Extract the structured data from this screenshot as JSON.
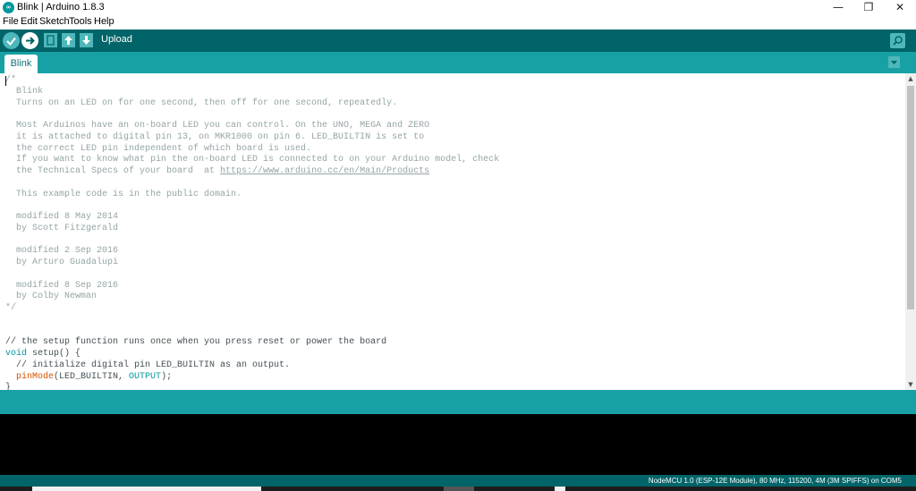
{
  "window": {
    "title": "Blink | Arduino 1.8.3",
    "app_icon_text": "∞",
    "controls": {
      "minimize": "—",
      "maximize": "❐",
      "close": "✕"
    }
  },
  "menu": [
    "File",
    "Edit",
    "Sketch",
    "Tools",
    "Help"
  ],
  "toolbar": {
    "status_label": "Upload",
    "buttons": [
      {
        "name": "verify",
        "icon": "checkmark-icon",
        "glyph": "✓"
      },
      {
        "name": "upload",
        "icon": "arrow-right-icon",
        "glyph": "➜"
      },
      {
        "name": "new",
        "icon": "new-file-icon"
      },
      {
        "name": "open",
        "icon": "arrow-up-icon",
        "glyph": "⬆"
      },
      {
        "name": "save",
        "icon": "arrow-down-icon",
        "glyph": "⬇"
      }
    ],
    "serial_monitor_icon": "magnifier-icon",
    "serial_monitor_glyph": "⌕"
  },
  "tabs": [
    {
      "label": "Blink",
      "active": true
    }
  ],
  "tab_menu_glyph": "▾",
  "editor": {
    "lines": [
      {
        "text": "/*",
        "kind": "comment"
      },
      {
        "text": "  Blink",
        "kind": "comment"
      },
      {
        "text": "  Turns on an LED on for one second, then off for one second, repeatedly.",
        "kind": "comment"
      },
      {
        "text": "",
        "kind": "comment"
      },
      {
        "text": "  Most Arduinos have an on-board LED you can control. On the UNO, MEGA and ZERO",
        "kind": "comment"
      },
      {
        "text": "  it is attached to digital pin 13, on MKR1000 on pin 6. LED_BUILTIN is set to",
        "kind": "comment"
      },
      {
        "text": "  the correct LED pin independent of which board is used.",
        "kind": "comment"
      },
      {
        "text": "  If you want to know what pin the on-board LED is connected to on your Arduino model, check",
        "kind": "comment"
      },
      {
        "text": "  the Technical Specs of your board  at ",
        "kind": "comment",
        "link": "https://www.arduino.cc/en/Main/Products"
      },
      {
        "text": "",
        "kind": "comment"
      },
      {
        "text": "  This example code is in the public domain.",
        "kind": "comment"
      },
      {
        "text": "",
        "kind": "comment"
      },
      {
        "text": "  modified 8 May 2014",
        "kind": "comment"
      },
      {
        "text": "  by Scott Fitzgerald",
        "kind": "comment"
      },
      {
        "text": "",
        "kind": "comment"
      },
      {
        "text": "  modified 2 Sep 2016",
        "kind": "comment"
      },
      {
        "text": "  by Arturo Guadalupi",
        "kind": "comment"
      },
      {
        "text": "",
        "kind": "comment"
      },
      {
        "text": "  modified 8 Sep 2016",
        "kind": "comment"
      },
      {
        "text": "  by Colby Newman",
        "kind": "comment"
      },
      {
        "text": "*/",
        "kind": "comment"
      },
      {
        "text": "",
        "kind": "plain"
      },
      {
        "text": "",
        "kind": "plain"
      },
      {
        "text": "// the setup function runs once when you press reset or power the board",
        "kind": "plain"
      },
      {
        "kind": "setup"
      },
      {
        "text": "  // initialize digital pin LED_BUILTIN as an output.",
        "kind": "plain"
      },
      {
        "kind": "pinmode"
      },
      {
        "text": "}",
        "kind": "plain"
      }
    ],
    "tokens": {
      "void": "void",
      "setup_rest": " setup() {",
      "indent": "  ",
      "pinMode": "pinMode",
      "pin_open": "(LED_BUILTIN, ",
      "OUTPUT": "OUTPUT",
      "pin_close": ");"
    }
  },
  "scrollbar": {
    "up": "▲",
    "down": "▼"
  },
  "status_bar": {
    "board_info": "NodeMCU 1.0 (ESP-12E Module), 80 MHz, 115200, 4M (3M SPIFFS) on COM5"
  },
  "colors": {
    "toolbar": "#006468",
    "tabbar": "#17a1a5",
    "comment": "#95a5a6",
    "keyword": "#00979c",
    "function": "#d35400",
    "console": "#000000"
  }
}
